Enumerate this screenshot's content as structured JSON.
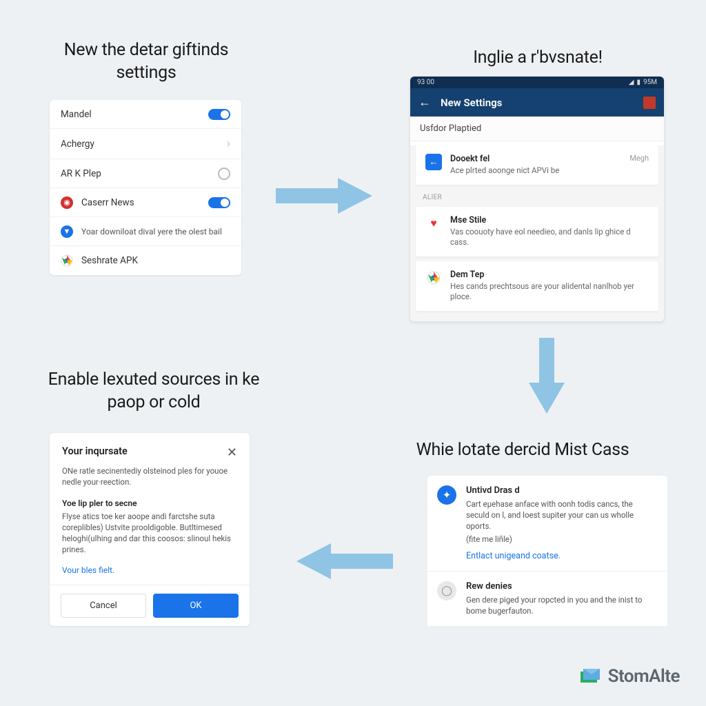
{
  "panel1": {
    "heading": "New the detar giftinds settings",
    "rows": {
      "mandel": "Mandel",
      "achergy": "Achergy",
      "arkplep": "AR K Plep",
      "caser": "Caserr News",
      "download": "Yoar downiloat dival yere the olest bail",
      "seshate": "Seshrate APK"
    }
  },
  "panel2": {
    "heading": "Inglie a r'bvsnate!",
    "status_time": "93 00",
    "status_batt": "95M",
    "appbar_title": "New Settings",
    "subheader": "Usfdor Plaptied",
    "section_label": "ALIER",
    "items": [
      {
        "title": "Dooekt fel",
        "desc": "Ace plrted aoonge nict APVi be",
        "meta": "Megh"
      },
      {
        "title": "Mse Stile",
        "desc": "Vas coouoty have eol needieo, and danls lip ghice d cass."
      },
      {
        "title": "Dem Tep",
        "desc": "Hes cands prechtsous are your alidental nanlhob yer ploce."
      }
    ]
  },
  "panel3": {
    "heading": "Enable lexuted sources in ke paop or cold",
    "title": "Your inqursate",
    "text1": "ONe ratle secinentediy olsteinod ples for youoe nedle your·reection.",
    "sub": "Yoe lip pler to secne",
    "text2": "Flyse atics toe ker aoope andi farctshe suta coreplibles) Ustvite prooldigoble. Butltimesed heloghi(ulhing and dar this coosos: slinoul hekis prines.",
    "link": "Vour bles fielt.",
    "cancel": "Cancel",
    "ok": "OK"
  },
  "panel4": {
    "heading": "Whie lotate dercid Mist Cass",
    "items": [
      {
        "title": "Untivd Dras d",
        "desc": "Cart eµehase anface with oonh todis cancs, the seculd on l, and loest supiter your can us wholle oports.",
        "paren": "(fite me liñle)",
        "link": "Entlact unigeand coatse."
      },
      {
        "title": "Rew denies",
        "desc": "Gen dere piged your ropcted in you and the inist to bome bugerfauton."
      }
    ]
  },
  "brand": "StomAlte"
}
